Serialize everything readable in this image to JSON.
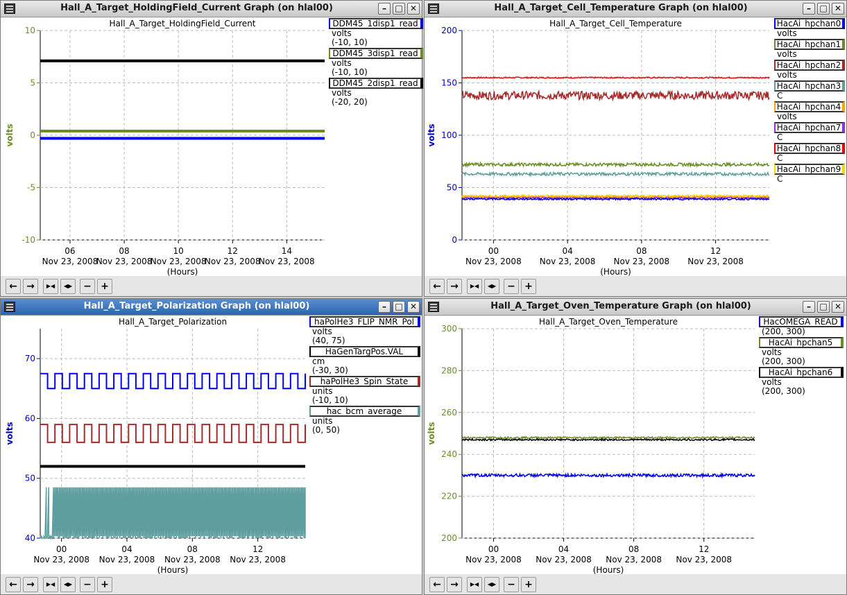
{
  "windows": [
    {
      "id": "w1",
      "window_title": "Hall_A_Target_HoldingField_Current Graph (on hlal00)",
      "active": false,
      "chart_title": "Hall_A_Target_HoldingField_Current",
      "ylabel": "volts",
      "ylabel_color": "#6b8e23",
      "ytick_color": "#6b8e23",
      "xlabel": "(Hours)",
      "legend": [
        {
          "name": "DDM45_1disp1_read",
          "unit": "volts",
          "range": "(-10, 10)",
          "color": "#0000ee"
        },
        {
          "name": "DDM45_3disp1_read",
          "unit": "volts",
          "range": "(-10, 10)",
          "color": "#6b8e23"
        },
        {
          "name": "DDM45_2disp1_read",
          "unit": "volts",
          "range": "(-20, 20)",
          "color": "#000000"
        }
      ]
    },
    {
      "id": "w2",
      "window_title": "Hall_A_Target_Cell_Temperature Graph (on hlal00)",
      "active": false,
      "chart_title": "Hall_A_Target_Cell_Temperature",
      "ylabel": "volts",
      "ylabel_color": "#0000cc",
      "ytick_color": "#0000cc",
      "xlabel": "(Hours)",
      "legend": [
        {
          "name": "HacAi_hpchan0",
          "unit": "volts",
          "color": "#0000ee"
        },
        {
          "name": "HacAi_hpchan1",
          "unit": "volts",
          "color": "#6b8e23"
        },
        {
          "name": "HacAi_hpchan2",
          "unit": "volts",
          "color": "#a52a2a"
        },
        {
          "name": "HacAi_hpchan3",
          "unit": "C",
          "color": "#5f9ea0"
        },
        {
          "name": "HacAi_hpchan4",
          "unit": "volts",
          "color": "#ffa500"
        },
        {
          "name": "HacAi_hpchan7",
          "unit": "C",
          "color": "#9932cc"
        },
        {
          "name": "HacAi_hpchan8",
          "unit": "C",
          "color": "#ee0000"
        },
        {
          "name": "HacAi_hpchan9",
          "unit": "C",
          "color": "#ffd700"
        }
      ]
    },
    {
      "id": "w3",
      "window_title": "Hall_A_Target_Polarization Graph (on hlal00)",
      "active": true,
      "chart_title": "Hall_A_Target_Polarization",
      "ylabel": "volts",
      "ylabel_color": "#0000cc",
      "ytick_color": "#0000cc",
      "xlabel": "(Hours)",
      "legend": [
        {
          "name": "haPolHe3_FLIP_NMR_Pol",
          "unit": "volts",
          "range": "(40, 75)",
          "color": "#0000ee"
        },
        {
          "name": "HaGenTargPos.VAL",
          "unit": "cm",
          "range": "(-30, 30)",
          "color": "#000000"
        },
        {
          "name": "haPolHe3_Spin_State",
          "unit": "units",
          "range": "(-10, 10)",
          "color": "#a52a2a"
        },
        {
          "name": "hac_bcm_average",
          "unit": "units",
          "range": "(0, 50)",
          "color": "#5f9ea0"
        }
      ]
    },
    {
      "id": "w4",
      "window_title": "Hall_A_Target_Oven_Temperature Graph (on hlal00)",
      "active": false,
      "chart_title": "Hall_A_Target_Oven_Temperature",
      "ylabel": "volts",
      "ylabel_color": "#6b8e23",
      "ytick_color": "#6b8e23",
      "xlabel": "(Hours)",
      "legend": [
        {
          "name": "HacOMEGA_READ",
          "unit": "",
          "range": "(200, 300)",
          "color": "#0000ee"
        },
        {
          "name": "HacAi_hpchan5",
          "unit": "volts",
          "range": "(200, 300)",
          "color": "#6b8e23"
        },
        {
          "name": "HacAi_hpchan6",
          "unit": "volts",
          "range": "(200, 300)",
          "color": "#000000"
        }
      ]
    }
  ],
  "toolbar": {
    "icons": [
      "arrow-left-icon",
      "arrow-right-icon",
      "zoom-in-x-icon",
      "zoom-out-x-icon",
      "minus-icon",
      "plus-icon"
    ],
    "glyphs": [
      "←",
      "→",
      "▶◀",
      "◀▶",
      "−",
      "+"
    ]
  },
  "window_buttons": {
    "minimize": "–",
    "maximize": "□",
    "close": "✕"
  },
  "chart_data": [
    {
      "type": "line",
      "title": "Hall_A_Target_HoldingField_Current",
      "ylabel": "volts",
      "xlabel": "(Hours)",
      "xlim": [
        4.9,
        15.4
      ],
      "ylim": [
        -10,
        10
      ],
      "yticks": [
        10,
        5,
        0,
        -5,
        -10
      ],
      "xticks": [
        {
          "x": 6,
          "label": "06",
          "date": "Nov 23, 2008"
        },
        {
          "x": 8,
          "label": "08",
          "date": "Nov 23, 2008"
        },
        {
          "x": 10,
          "label": "10",
          "date": "Nov 23, 2008"
        },
        {
          "x": 12,
          "label": "12",
          "date": "Nov 23, 2008"
        },
        {
          "x": 14,
          "label": "14",
          "date": "Nov 23, 2008"
        }
      ],
      "grid": true,
      "series": [
        {
          "name": "DDM45_1disp1_read",
          "color": "#0000ee",
          "constant": -0.3,
          "range": [
            -10,
            10
          ]
        },
        {
          "name": "DDM45_3disp1_read",
          "color": "#6b8e23",
          "constant": 0.4,
          "range": [
            -10,
            10
          ]
        },
        {
          "name": "DDM45_2disp1_read",
          "color": "#000000",
          "constant": 14.2,
          "range": [
            -20,
            20
          ]
        }
      ]
    },
    {
      "type": "line",
      "title": "Hall_A_Target_Cell_Temperature",
      "ylabel": "volts",
      "xlabel": "(Hours)",
      "xlim": [
        -1.7,
        14.9
      ],
      "ylim": [
        0,
        200
      ],
      "yticks": [
        200,
        150,
        100,
        50,
        0
      ],
      "xticks": [
        {
          "x": 0,
          "label": "00",
          "date": "Nov 23, 2008"
        },
        {
          "x": 4,
          "label": "04",
          "date": "Nov 23, 2008"
        },
        {
          "x": 8,
          "label": "08",
          "date": "Nov 23, 2008"
        },
        {
          "x": 12,
          "label": "12",
          "date": "Nov 23, 2008"
        }
      ],
      "grid": true,
      "series": [
        {
          "name": "HacAi_hpchan8",
          "color": "#ee0000",
          "level": 155,
          "noise": 0.6
        },
        {
          "name": "HacAi_hpchan2",
          "color": "#a52a2a",
          "level": 138,
          "noise": 4
        },
        {
          "name": "HacAi_hpchan1",
          "color": "#6b8e23",
          "level": 72,
          "noise": 1.5
        },
        {
          "name": "HacAi_hpchan3",
          "color": "#5f9ea0",
          "level": 63,
          "noise": 1.5
        },
        {
          "name": "HacAi_hpchan9",
          "color": "#ffd700",
          "level": 42,
          "noise": 1
        },
        {
          "name": "HacAi_hpchan4",
          "color": "#ffa500",
          "level": 41,
          "noise": 1
        },
        {
          "name": "HacAi_hpchan7",
          "color": "#9932cc",
          "level": 40,
          "noise": 0.8
        },
        {
          "name": "HacAi_hpchan0",
          "color": "#0000ee",
          "level": 39,
          "noise": 0.8
        }
      ]
    },
    {
      "type": "line",
      "title": "Hall_A_Target_Polarization",
      "ylabel": "volts",
      "xlabel": "(Hours)",
      "xlim": [
        -1.3,
        14.9
      ],
      "ylim": [
        40,
        75
      ],
      "yticks": [
        70,
        60,
        50,
        40
      ],
      "xticks": [
        {
          "x": 0,
          "label": "00",
          "date": "Nov 23, 2008"
        },
        {
          "x": 4,
          "label": "04",
          "date": "Nov 23, 2008"
        },
        {
          "x": 8,
          "label": "08",
          "date": "Nov 23, 2008"
        },
        {
          "x": 12,
          "label": "12",
          "date": "Nov 23, 2008"
        }
      ],
      "grid": true,
      "series": [
        {
          "name": "haPolHe3_FLIP_NMR_Pol",
          "color": "#0000ee",
          "square_wave": {
            "low": 65,
            "high": 67.5
          }
        },
        {
          "name": "haPolHe3_Spin_State",
          "color": "#a52a2a",
          "square_wave": {
            "low": 56,
            "high": 59
          }
        },
        {
          "name": "HaGenTargPos.VAL",
          "color": "#000000",
          "constant": 52
        },
        {
          "name": "hac_bcm_average",
          "color": "#5f9ea0",
          "band": {
            "low": 40,
            "high": 48.5
          }
        }
      ]
    },
    {
      "type": "line",
      "title": "Hall_A_Target_Oven_Temperature",
      "ylabel": "volts",
      "xlabel": "(Hours)",
      "xlim": [
        -1.8,
        14.9
      ],
      "ylim": [
        200,
        300
      ],
      "yticks": [
        300,
        280,
        260,
        240,
        220,
        200
      ],
      "xticks": [
        {
          "x": 0,
          "label": "00",
          "date": "Nov 23, 2008"
        },
        {
          "x": 4,
          "label": "04",
          "date": "Nov 23, 2008"
        },
        {
          "x": 8,
          "label": "08",
          "date": "Nov 23, 2008"
        },
        {
          "x": 12,
          "label": "12",
          "date": "Nov 23, 2008"
        }
      ],
      "grid": true,
      "series": [
        {
          "name": "HacAi_hpchan5",
          "color": "#6b8e23",
          "level": 248,
          "noise": 0.4
        },
        {
          "name": "HacAi_hpchan6",
          "color": "#000000",
          "level": 247,
          "noise": 0.4
        },
        {
          "name": "HacOMEGA_READ",
          "color": "#0000ee",
          "level": 230,
          "noise": 0.7
        }
      ]
    }
  ]
}
